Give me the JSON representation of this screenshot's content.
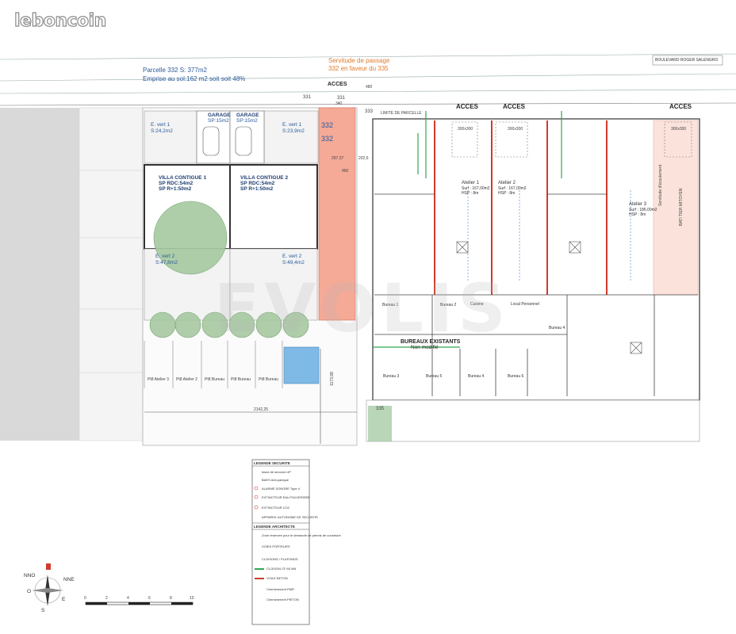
{
  "logo": "leboncoin",
  "header": {
    "road": "BOULEVARD ROGER SALENGRO",
    "parcel_title": "Parcelle 332 S:   377m2",
    "parcel_sub": "Emprise au sol:162 m2 soit  soit 48%",
    "servitude_1": "Servitude de passage",
    "servitude_2": "332 en faveur du 335",
    "acces_top": "ACCES"
  },
  "parcels": {
    "p331_a": "331",
    "p331_b": "331",
    "p332_a": "332",
    "p332_b": "332",
    "p333": "333",
    "p335": "335"
  },
  "dims": {
    "d340": "340",
    "d460": "460",
    "d297": "297.37",
    "d202": "202,6",
    "d480": "480",
    "d2142": "2142,25",
    "d1173": "1173,98"
  },
  "left_lot": {
    "ev1_left": {
      "name": "E. vert 1",
      "area": "S:24,2m2"
    },
    "ev1_right": {
      "name": "E. vert 1",
      "area": "S:23,9m2"
    },
    "garage_1": {
      "name": "GARAGE",
      "area": "SP:15m2"
    },
    "garage_2": {
      "name": "GARAGE",
      "area": "SP:15m2"
    },
    "villa_1": {
      "name": "VILLA CONTIGUE 1",
      "rdc": "SP RDC:54m2",
      "r1": "SP R+1:50m2"
    },
    "villa_2": {
      "name": "VILLA CONTIGUE 2",
      "rdc": "SP RDC:54m2",
      "r1": "SP R+1:50m2"
    },
    "ev2_left": {
      "name": "E. vert 2",
      "area": "S:47,8m2"
    },
    "ev2_right": {
      "name": "E. vert 2",
      "area": "S:49,4m2"
    },
    "parking": [
      "Pt8 Atelier 3",
      "Pt8 Atelier 2",
      "Pt8 Bureau",
      "Pt8 Bureau",
      "Pt8 Bureau"
    ]
  },
  "right_lot": {
    "acces": [
      "ACCES",
      "ACCES",
      "ACCES"
    ],
    "limite": "LIMITE DE PARCELLE",
    "ateliers": [
      {
        "name": "Atelier 1",
        "surf": "Surf : 167,00m2",
        "hsp": "HSP : 8m"
      },
      {
        "name": "Atelier 2",
        "surf": "Surf : 167,00m2",
        "hsp": "HSP : 8m"
      },
      {
        "name": "Atelier 3",
        "surf": "Surf : 186,00m2",
        "hsp": "HSP : 8m"
      }
    ],
    "bureaux_title": "BUREAUX EXISTANTS",
    "bureaux_sub": "Non modifié",
    "bureaux": [
      "Bureau 1",
      "Bureau 2",
      "Bureau 3",
      "Bureau 4",
      "Bureau 5",
      "Bureau 6",
      "Cuisine",
      "Local Personnel",
      "Bureau 4"
    ],
    "door_codes": [
      "300x300",
      "300x300",
      "300x300"
    ],
    "side_labels": [
      "BATI TIER MITOYEN",
      "Servitude d'écoulement"
    ]
  },
  "legend": {
    "security_title": "LEGENDE SECURITE",
    "security_items": [
      "Issue de secours UP",
      "BAES Anti-panique",
      "ALARME SONORE Type 4",
      "EXTINCTEUR EAU PULVERISEE",
      "EXTINCTEUR CO2",
      "APPAREIL AUTONOME DE SECURITE"
    ],
    "architect_title": "LEGENDE ARCHITECTE",
    "architect_items": [
      "Zone réservée pour le demande de permis de construire",
      "VOIES PORTEURS",
      "CLOISONS / PLAFONDS",
      "CLOISON CF 60 MN",
      "VOILE BETON",
      "Cheminement PMR",
      "Cheminement PIETON"
    ]
  },
  "compass": {
    "nno": "NNO",
    "nne": "NNE",
    "o": "O",
    "e": "E",
    "s": "S"
  },
  "scale": {
    "ticks": [
      "0",
      "2",
      "4",
      "6",
      "8",
      "10"
    ]
  },
  "watermark": "EVOLIS",
  "colors": {
    "salmon": "#f5a997",
    "green_line": "#2fa84f",
    "red_wall": "#d23a2a",
    "blue_text": "#2a5a9a",
    "orange_text": "#e07a2a",
    "grey_zone": "#d8d8d8",
    "parking_blue": "#7fb9e6"
  }
}
